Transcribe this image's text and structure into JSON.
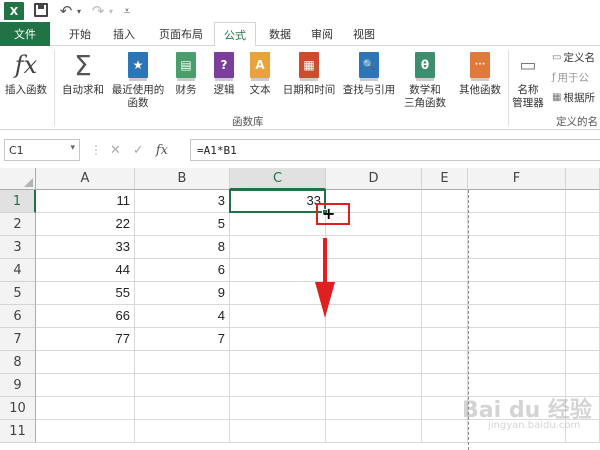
{
  "app": {
    "logo": "X"
  },
  "qat": {
    "undo_icon": "undo-arrow",
    "redo_icon": "redo-arrow"
  },
  "tabs": [
    {
      "label": "文件"
    },
    {
      "label": "开始"
    },
    {
      "label": "插入"
    },
    {
      "label": "页面布局"
    },
    {
      "label": "公式"
    },
    {
      "label": "数据"
    },
    {
      "label": "审阅"
    },
    {
      "label": "视图"
    }
  ],
  "ribbon": {
    "insert_function": {
      "icon": "fx",
      "label": "插入函数"
    },
    "autosum": {
      "icon": "Σ",
      "label": "自动求和"
    },
    "recent": {
      "icon": "★",
      "line1": "最近使用的",
      "line2": "函数"
    },
    "financial": {
      "icon": "▤",
      "label": "财务"
    },
    "logical": {
      "icon": "?",
      "label": "逻辑"
    },
    "text": {
      "icon": "A",
      "label": "文本"
    },
    "datetime": {
      "icon": "▦",
      "label": "日期和时间"
    },
    "lookup": {
      "icon": "🔍",
      "label": "查找与引用"
    },
    "math": {
      "icon": "θ",
      "line1": "数学和",
      "line2": "三角函数"
    },
    "more": {
      "icon": "···",
      "label": "其他函数"
    },
    "group_label": "函数库",
    "name_manager": {
      "line1": "名称",
      "line2": "管理器"
    },
    "define_name": "定义名",
    "use_in_formula": "用于公",
    "create_from_selection": "根据所",
    "defined_names_label": "定义的名"
  },
  "formula_bar": {
    "name_box": "C1",
    "fx": "fx",
    "formula": "=A1*B1"
  },
  "columns": [
    "A",
    "B",
    "C",
    "D",
    "E",
    "F"
  ],
  "rows": [
    "1",
    "2",
    "3",
    "4",
    "5",
    "6",
    "7",
    "8",
    "9",
    "10",
    "11"
  ],
  "cells": {
    "A": [
      "11",
      "22",
      "33",
      "44",
      "55",
      "66",
      "77",
      "",
      "",
      "",
      ""
    ],
    "B": [
      "3",
      "5",
      "8",
      "6",
      "9",
      "4",
      "7",
      "",
      "",
      "",
      ""
    ],
    "C": [
      "33",
      "",
      "",
      "",
      "",
      "",
      "",
      "",
      "",
      "",
      ""
    ]
  },
  "active_cell": "C1",
  "annotation": {
    "color": "#e02020"
  },
  "watermark": {
    "brand": "Bai du 经验",
    "url": "jingyan.baidu.com"
  }
}
